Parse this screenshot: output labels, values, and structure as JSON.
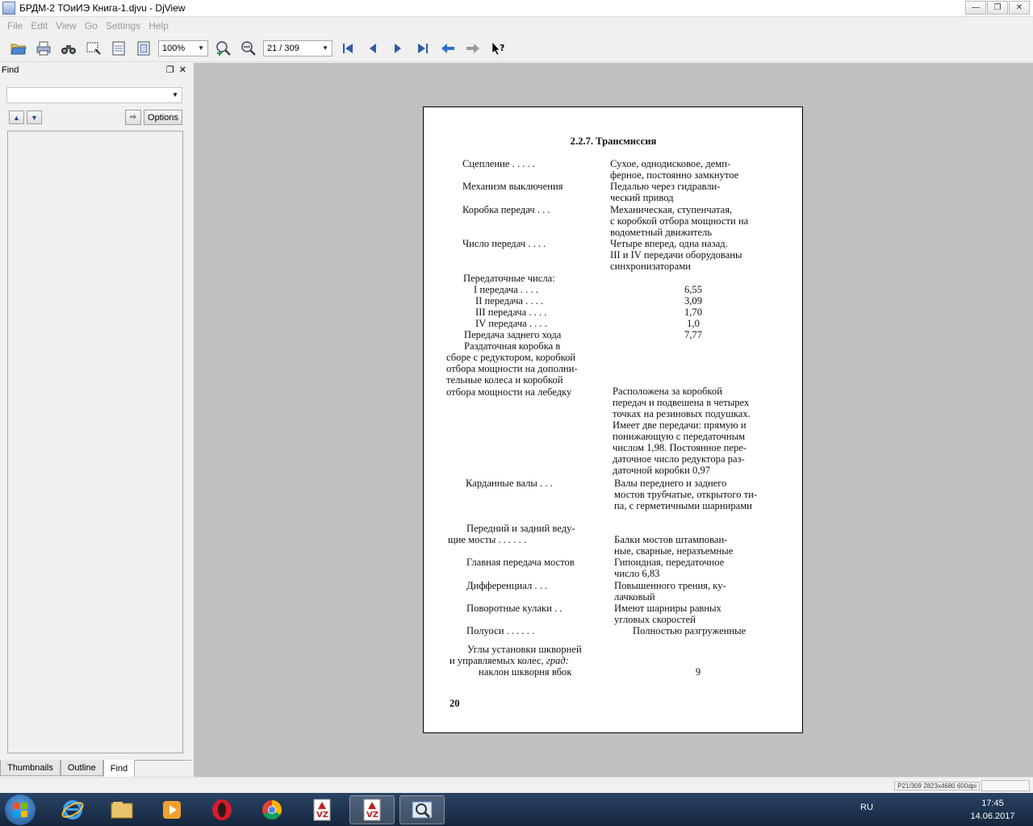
{
  "window": {
    "title": "БРДМ-2 ТОиИЭ Книга-1.djvu - DjView"
  },
  "menu": [
    "File",
    "Edit",
    "View",
    "Go",
    "Settings",
    "Help"
  ],
  "toolbar": {
    "zoom": "100%",
    "page": "21 / 309"
  },
  "find_panel": {
    "title": "Find",
    "search_value": "",
    "options_label": "Options"
  },
  "tabs": [
    "Thumbnails",
    "Outline",
    "Find"
  ],
  "page": {
    "title": "2.2.7. Трансмиссия",
    "labels": {
      "l1": "Сцепление . . . . .",
      "l2": "Механизм выключения",
      "l3": "Коробка передач . . .",
      "l4": "Число передач . . . .",
      "l5": "Передаточные числа:",
      "l6": "I передача . . . .",
      "l7": "II передача . . . .",
      "l8": "III передача . . . .",
      "l9": "IV передача . . . .",
      "l10": "Передача заднего хода",
      "l11a": "Раздаточная коробка в",
      "l11b": "сборе с редуктором, коробкой",
      "l11c": "отбора мощности на дополни-",
      "l11d": "тельные колеса и коробкой",
      "l11e": "отбора мощности на лебедку",
      "l12": "Карданные валы . . .",
      "l13a": "Передний и задний веду-",
      "l13b": "щие мосты . . . . . .",
      "l14": "Главная передача мостов",
      "l15": "Дифференциал . . .",
      "l16": "Поворотные кулаки . .",
      "l17": "Полуоси . . . . . .",
      "l18a": "Углы установки шкворней",
      "l18b": "и управляемых колес,",
      "l18c": "град:",
      "l19": "наклон шкворня вбок"
    },
    "values": {
      "v1a": "Сухое, однодисковое, демп-",
      "v1b": "ферное, постоянно замкнутое",
      "v2a": "Педалью через гидравли-",
      "v2b": "ческий привод",
      "v3a": "Механическая, ступенчатая,",
      "v3b": "с коробкой отбора мощности на",
      "v3c": "водометный движитель",
      "v4a": "Четыре вперед, одна назад.",
      "v4b": "III и IV передачи оборудованы",
      "v4c": "синхронизаторами",
      "r1": "6,55",
      "r2": "3,09",
      "r3": "1,70",
      "r4": "1,0",
      "r5": "7,77",
      "v11a": "Расположена за коробкой",
      "v11b": "передач и подвешена в четырех",
      "v11c": "точках на резиновых подушках.",
      "v11d": "Имеет две передачи: прямую и",
      "v11e": "понижающую с передаточным",
      "v11f": "числом 1,98. Постоянное пере-",
      "v11g": "даточное число редуктора раз-",
      "v11h": "даточной коробки 0,97",
      "v12a": "Валы переднего и заднего",
      "v12b": "мостов трубчатые, открытого ти-",
      "v12c": "па, с герметичными шарнирами",
      "v13a": "Балки мостов штампован-",
      "v13b": "ные, сварные, неразъемные",
      "v14a": "Гипоидная, передаточное",
      "v14b": "число 6,83",
      "v15a": "Повышенного трения, ку-",
      "v15b": "лачковый",
      "v16a": "Имеют шарниры равных",
      "v16b": "угловых скоростей",
      "v17": "Полностью разгруженные",
      "v19": "9"
    },
    "page_number": "20"
  },
  "status": {
    "text": "P21/309 2823x4680 600dpi"
  },
  "taskbar": {
    "lang": "RU",
    "time": "17:45",
    "date": "14.06.2017"
  }
}
